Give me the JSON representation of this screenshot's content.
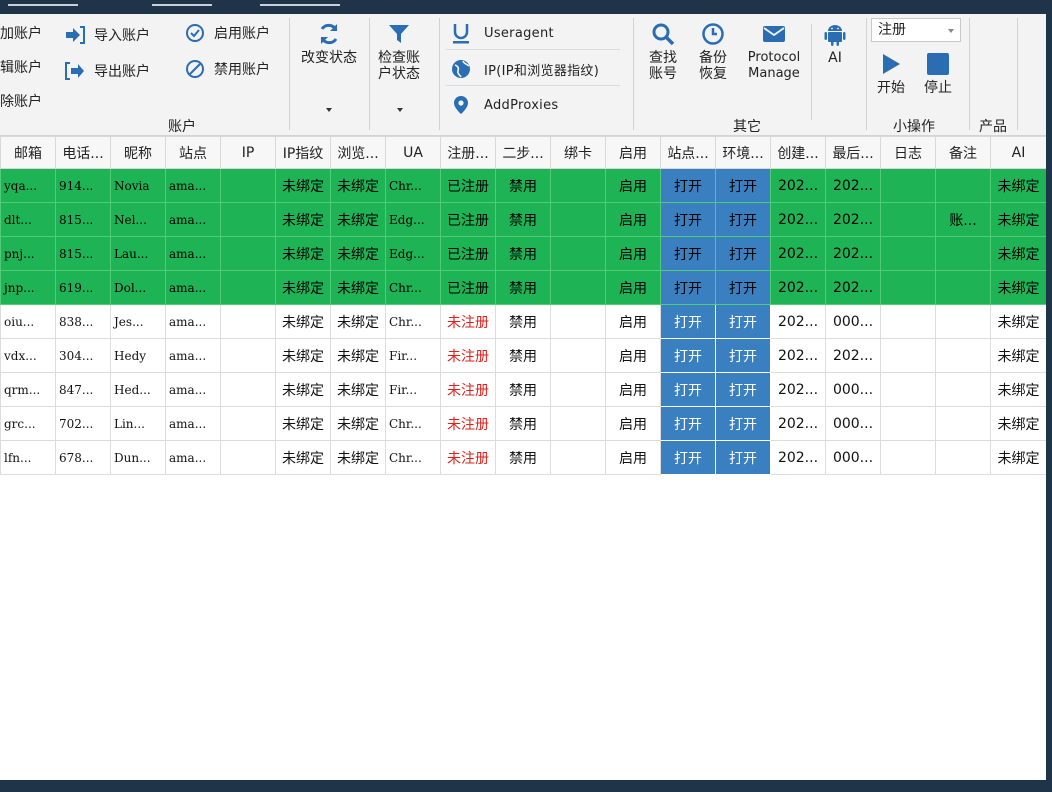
{
  "ribbon": {
    "account_group": {
      "title": "账户",
      "add": "加账户",
      "edit": "辑账户",
      "delete": "除账户",
      "import": "导入账户",
      "export": "导出账户",
      "enable": "启用账户",
      "disable": "禁用账户"
    },
    "change_status": "改变状态",
    "check_status": "检查账户状态",
    "middle": {
      "useragent": "Useragent",
      "ip": "IP(IP和浏览器指纹)",
      "proxies": "AddProxies"
    },
    "other_group": {
      "title": "其它",
      "find": "查找账号",
      "backup": "备份恢复",
      "protocol": "Protocol Manage",
      "ai": "AI"
    },
    "ops_group": {
      "title": "小操作",
      "mode_value": "注册",
      "start": "开始",
      "stop": "停止"
    },
    "product_group": {
      "title": "产品"
    }
  },
  "table": {
    "columns": [
      "邮箱",
      "电话...",
      "昵称",
      "站点",
      "IP",
      "IP指纹",
      "浏览...",
      "UA",
      "注册...",
      "二步...",
      "绑卡",
      "启用",
      "站点...",
      "环境...",
      "创建...",
      "最后...",
      "日志",
      "备注",
      "AI"
    ],
    "rows": [
      {
        "highlight": true,
        "cells": [
          "yqa...",
          "914...",
          "Novia",
          "ama...",
          "",
          "未绑定",
          "未绑定",
          "Chr...",
          "已注册",
          "禁用",
          "",
          "启用",
          "打开",
          "打开",
          "202...",
          "202...",
          "",
          "",
          "未绑定"
        ]
      },
      {
        "highlight": true,
        "cells": [
          "dlt...",
          "815...",
          "Nel...",
          "ama...",
          "",
          "未绑定",
          "未绑定",
          "Edg...",
          "已注册",
          "禁用",
          "",
          "启用",
          "打开",
          "打开",
          "202...",
          "202...",
          "",
          "账...",
          "未绑定"
        ]
      },
      {
        "highlight": true,
        "cells": [
          "pnj...",
          "815...",
          "Lau...",
          "ama...",
          "",
          "未绑定",
          "未绑定",
          "Edg...",
          "已注册",
          "禁用",
          "",
          "启用",
          "打开",
          "打开",
          "202...",
          "202...",
          "",
          "",
          "未绑定"
        ]
      },
      {
        "highlight": true,
        "cells": [
          "jnp...",
          "619...",
          "Dol...",
          "ama...",
          "",
          "未绑定",
          "未绑定",
          "Chr...",
          "已注册",
          "禁用",
          "",
          "启用",
          "打开",
          "打开",
          "202...",
          "202...",
          "",
          "",
          "未绑定"
        ]
      },
      {
        "highlight": false,
        "cells": [
          "oiu...",
          "838...",
          "Jes...",
          "ama...",
          "",
          "未绑定",
          "未绑定",
          "Chr...",
          "未注册",
          "禁用",
          "",
          "启用",
          "打开",
          "打开",
          "202...",
          "000...",
          "",
          "",
          "未绑定"
        ]
      },
      {
        "highlight": false,
        "cells": [
          "vdx...",
          "304...",
          "Hedy",
          "ama...",
          "",
          "未绑定",
          "未绑定",
          "Fir...",
          "未注册",
          "禁用",
          "",
          "启用",
          "打开",
          "打开",
          "202...",
          "202...",
          "",
          "",
          "未绑定"
        ]
      },
      {
        "highlight": false,
        "cells": [
          "qrm...",
          "847...",
          "Hed...",
          "ama...",
          "",
          "未绑定",
          "未绑定",
          "Fir...",
          "未注册",
          "禁用",
          "",
          "启用",
          "打开",
          "打开",
          "202...",
          "000...",
          "",
          "",
          "未绑定"
        ]
      },
      {
        "highlight": false,
        "cells": [
          "grc...",
          "702...",
          "Lin...",
          "ama...",
          "",
          "未绑定",
          "未绑定",
          "Chr...",
          "未注册",
          "禁用",
          "",
          "启用",
          "打开",
          "打开",
          "202...",
          "000...",
          "",
          "",
          "未绑定"
        ]
      },
      {
        "highlight": false,
        "cells": [
          "lfn...",
          "678...",
          "Dun...",
          "ama...",
          "",
          "未绑定",
          "未绑定",
          "Chr...",
          "未注册",
          "禁用",
          "",
          "启用",
          "打开",
          "打开",
          "202...",
          "000...",
          "",
          "",
          "未绑定"
        ]
      }
    ]
  },
  "colors": {
    "row_highlight": "#1eb354",
    "open_button": "#3a7fbf",
    "unregistered_text": "#e0201c",
    "icon_blue": "#2a6db3"
  }
}
